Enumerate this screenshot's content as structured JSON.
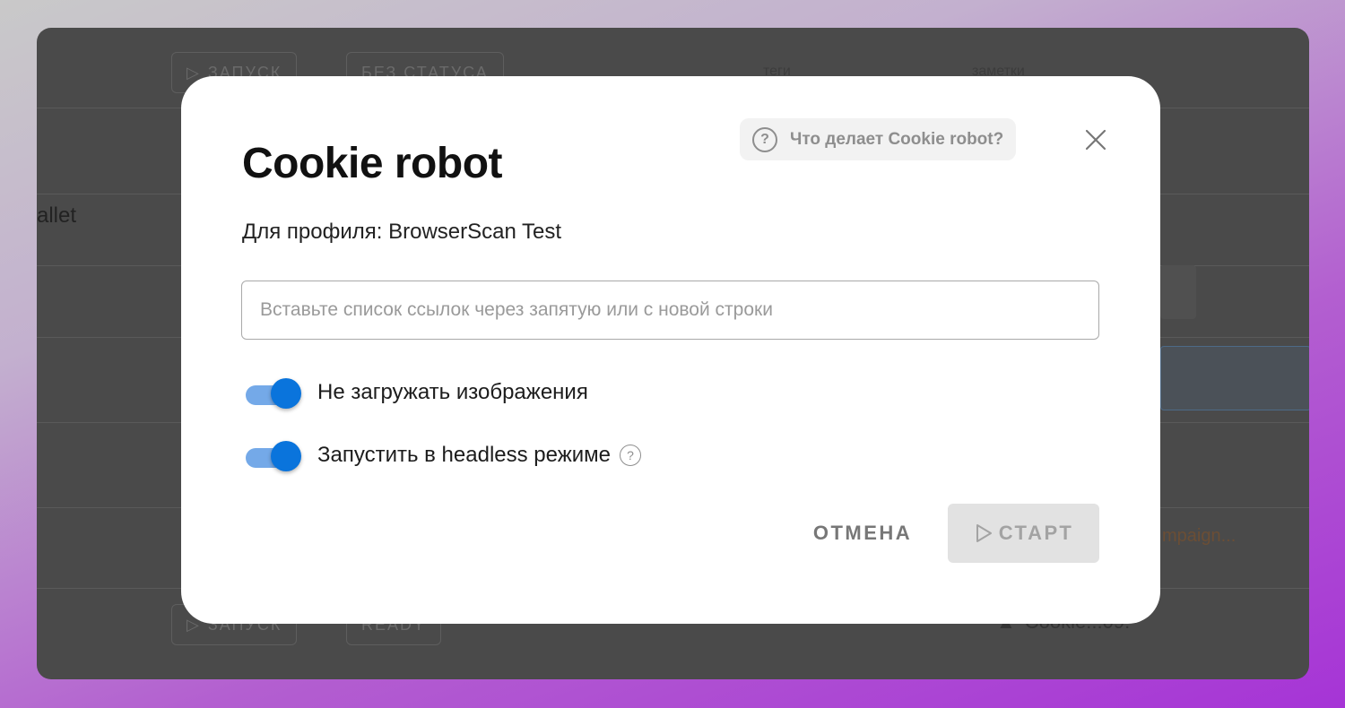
{
  "background": {
    "row1_btn_launch": "ЗАПУСК",
    "row1_btn_status": "БЕЗ СТАТУСА",
    "col_tags": "теги",
    "col_notes": "заметки",
    "wallet_fragment": "allet",
    "bottom_btn_launch": "ЗАПУСК",
    "bottom_btn_status": "READY",
    "campaign_fragment": "mpaign...",
    "notice_fragment": "Cookie...09."
  },
  "modal": {
    "title": "Cookie robot",
    "help_chip_label": "Что делает Cookie robot?",
    "profile_line": "Для профиля: BrowserScan Test",
    "links_placeholder": "Вставьте список ссылок через запятую или с новой строки",
    "links_value": "",
    "toggles": [
      {
        "label": "Не загружать изображения",
        "checked": true
      },
      {
        "label": "Запустить в headless режиме",
        "checked": true
      }
    ],
    "cancel_label": "ОТМЕНА",
    "start_label": "СТАРТ",
    "start_disabled": true
  },
  "colors": {
    "accent": "#0a74dc",
    "accent_light": "#74a9e8",
    "overlay": "#4a4a4a"
  },
  "icons": {
    "help": "question-circle-icon",
    "close": "close-icon",
    "play": "play-outline-icon"
  }
}
